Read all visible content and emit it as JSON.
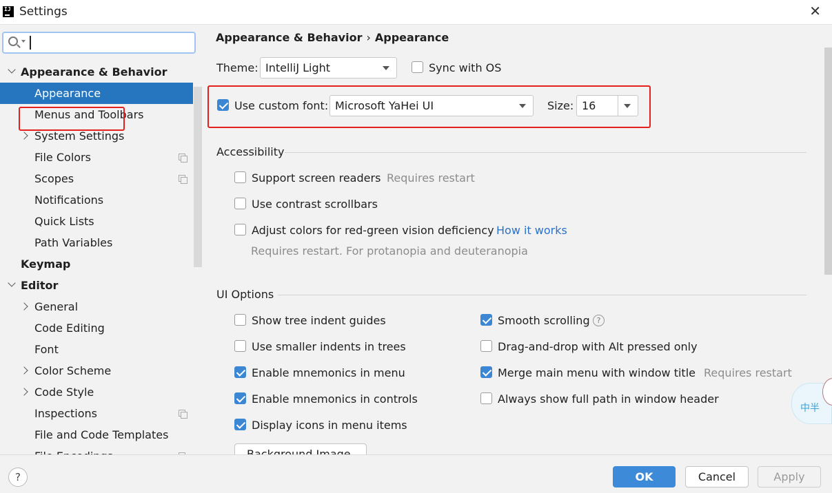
{
  "window": {
    "title": "Settings",
    "icon": "intellij-icon",
    "icon_text": "IJ"
  },
  "sidebar": {
    "search": {
      "value": "",
      "placeholder": ""
    },
    "items": [
      {
        "label": "Appearance & Behavior",
        "expanded": true,
        "bold": true
      },
      {
        "label": "Appearance",
        "selected": true
      },
      {
        "label": "Menus and Toolbars"
      },
      {
        "label": "System Settings",
        "expandable": true
      },
      {
        "label": "File Colors",
        "icon": "copy-icon"
      },
      {
        "label": "Scopes",
        "icon": "copy-icon"
      },
      {
        "label": "Notifications"
      },
      {
        "label": "Quick Lists"
      },
      {
        "label": "Path Variables"
      },
      {
        "label": "Keymap",
        "bold": true
      },
      {
        "label": "Editor",
        "expanded": true,
        "bold": true
      },
      {
        "label": "General",
        "expandable": true
      },
      {
        "label": "Code Editing"
      },
      {
        "label": "Font"
      },
      {
        "label": "Color Scheme",
        "expandable": true
      },
      {
        "label": "Code Style",
        "expandable": true
      },
      {
        "label": "Inspections",
        "icon": "copy-icon"
      },
      {
        "label": "File and Code Templates"
      },
      {
        "label": "File Encodings",
        "icon": "copy-icon"
      }
    ]
  },
  "breadcrumb": {
    "parent": "Appearance & Behavior",
    "separator": "›",
    "current": "Appearance"
  },
  "theme": {
    "label": "Theme:",
    "value": "IntelliJ Light",
    "sync_label": "Sync with OS",
    "sync_checked": false
  },
  "font": {
    "use_custom_label": "Use custom font:",
    "use_custom_checked": true,
    "font_value": "Microsoft YaHei UI",
    "size_label": "Size:",
    "size_value": "16"
  },
  "accessibility": {
    "title": "Accessibility",
    "screen_readers": {
      "label": "Support screen readers",
      "hint": "Requires restart",
      "checked": false
    },
    "contrast_scrollbars": {
      "label": "Use contrast scrollbars",
      "checked": false
    },
    "red_green": {
      "label": "Adjust colors for red-green vision deficiency",
      "link": "How it works",
      "hint": "Requires restart. For protanopia and deuteranopia",
      "checked": false
    }
  },
  "ui_options": {
    "title": "UI Options",
    "left": [
      {
        "label": "Show tree indent guides",
        "checked": false
      },
      {
        "label": "Use smaller indents in trees",
        "checked": false
      },
      {
        "label": "Enable mnemonics in menu",
        "checked": true
      },
      {
        "label": "Enable mnemonics in controls",
        "checked": true
      },
      {
        "label": "Display icons in menu items",
        "checked": true
      }
    ],
    "right": [
      {
        "label": "Smooth scrolling",
        "checked": true,
        "help": "?"
      },
      {
        "label": "Drag-and-drop with Alt pressed only",
        "checked": false
      },
      {
        "label": "Merge main menu with window title",
        "checked": true,
        "hint": "Requires restart"
      },
      {
        "label": "Always show full path in window header",
        "checked": false
      }
    ],
    "background_image_button": "Background Image..."
  },
  "overlay_widget": {
    "text": "中半"
  },
  "footer": {
    "help": "?",
    "ok": "OK",
    "cancel": "Cancel",
    "apply": "Apply"
  },
  "colors": {
    "accent": "#3d8bd8",
    "selection": "#2675bf",
    "highlight_outline": "#e3201b",
    "link": "#2b71c8"
  }
}
